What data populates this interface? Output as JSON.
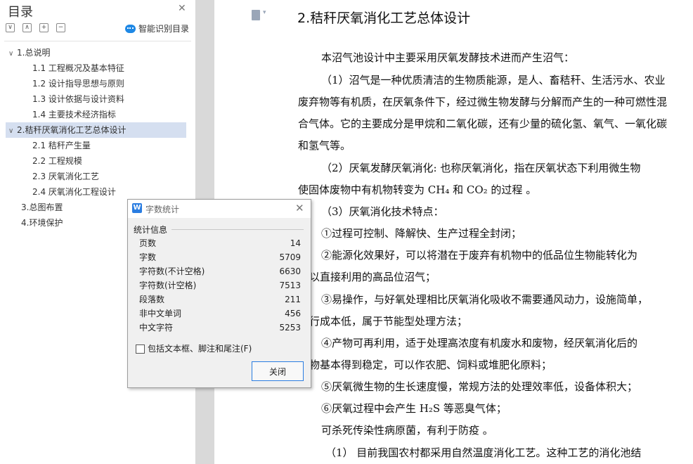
{
  "sidebar": {
    "title": "目录",
    "ai_button": "智能识别目录",
    "items": [
      {
        "label": "1.总说明",
        "arrow": "∨"
      },
      {
        "label": "1.1 工程概况及基本特征"
      },
      {
        "label": "1.2 设计指导思想与原则"
      },
      {
        "label": "1.3 设计依据与设计资料"
      },
      {
        "label": "1.4 主要技术经济指标"
      },
      {
        "label": "2.秸秆厌氧消化工艺总体设计",
        "arrow": "∨"
      },
      {
        "label": "2.1 秸秆产生量"
      },
      {
        "label": "2.2 工程规模"
      },
      {
        "label": "2.3 厌氧消化工艺"
      },
      {
        "label": "2.4 厌氧消化工程设计"
      },
      {
        "label": "3.总图布置"
      },
      {
        "label": "4.环境保护"
      }
    ]
  },
  "document": {
    "heading": "2.秸秆厌氧消化工艺总体设计",
    "lines": [
      "本沼气池设计中主要采用厌氧发酵技术进而产生沼气：",
      "（1）沼气是一种优质清洁的生物质能源，是人、畜秸秆、生活污水、农业",
      "废弃物等有机质，在厌氧条件下，经过微生物发酵与分解而产生的一种可燃性混",
      "合气体。它的主要成分是甲烷和二氧化碳，还有少量的硫化氢、氧气、一氧化碳",
      "和氢气等。",
      "（2）厌氧发酵厌氧消化: 也称厌氧消化，指在厌氧状态下利用微生物",
      "使固体废物中有机物转变为 CH₄ 和 CO₂ 的过程 。",
      "（3）厌氧消化技术特点：",
      "①过程可控制、降解快、生产过程全封闭；",
      "②能源化效果好，可以将潜在于废弃有机物中的低品位生物能转化为",
      "以直接利用的高品位沼气；",
      "③易操作，与好氧处理相比厌氧消化吸收不需要通风动力，设施简单，",
      "行成本低，属于节能型处理方法；",
      "④产物可再利用，适于处理高浓度有机废水和废物，经厌氧消化后的",
      "物基本得到稳定，可以作农肥、饲料或堆肥化原料；",
      "⑤厌氧微生物的生长速度慢，常规方法的处理效率低，设备体积大；",
      "⑥厌氧过程中会产生 H₂S 等恶臭气体；",
      "可杀死传染性病原菌，有利于防疫 。",
      "（1） 目前我国农村都采用自然温度消化工艺。这种工艺的消化池结"
    ]
  },
  "dialog": {
    "title": "字数统计",
    "section": "统计信息",
    "stats": [
      {
        "label": "页数",
        "value": "14"
      },
      {
        "label": "字数",
        "value": "5709"
      },
      {
        "label": "字符数(不计空格)",
        "value": "6630"
      },
      {
        "label": "字符数(计空格)",
        "value": "7513"
      },
      {
        "label": "段落数",
        "value": "211"
      },
      {
        "label": "非中文单词",
        "value": "456"
      },
      {
        "label": "中文字符",
        "value": "5253"
      }
    ],
    "checkbox_label": "包括文本框、脚注和尾注(F)",
    "close_button": "关闭"
  }
}
